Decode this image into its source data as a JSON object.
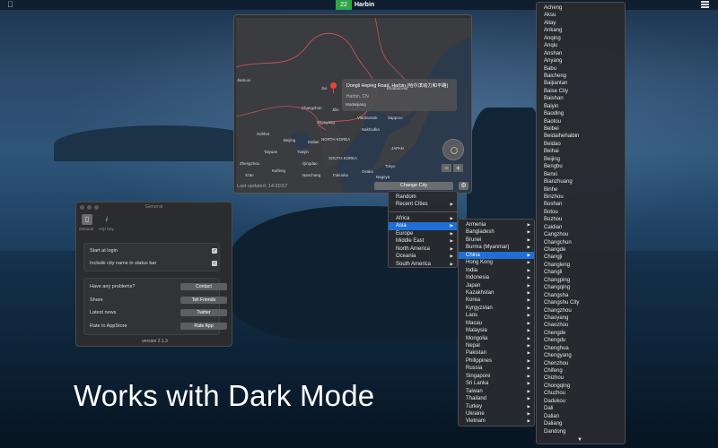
{
  "menubar": {
    "apple_icon": "apple-icon",
    "aqi_value": "22",
    "city": "Harbin",
    "list_icon": "list-icon"
  },
  "map": {
    "place_title": "Dongli Heping Road, Harbin (哈尔滨动力和平路)",
    "place_subtitle": "Harbin, CN",
    "labels": [
      "Jiamusi",
      "Jixi",
      "Khabarovsk",
      "Mudanjiang",
      "Changchun",
      "Jilin",
      "Shenyang",
      "Vladivostok",
      "Nakhodka",
      "Sapporo",
      "Hohhot",
      "Beijing",
      "Dalian",
      "NORTH KOREA",
      "Taiyuan",
      "Tianjin",
      "SOUTH KOREA",
      "JAPAN",
      "Tokyo",
      "Zhengzhou",
      "Qingdao",
      "Xi'an",
      "Kaifeng",
      "Nanchang",
      "Osaka",
      "Fukuoka",
      "Nagoya",
      "Jilin"
    ],
    "last_updated": "Last updated: 14:30:57",
    "change_city": "Change City",
    "zoom_out": "−",
    "zoom_in": "+",
    "gear_icon": "gear-icon"
  },
  "menu_top": {
    "random": "Random",
    "recent": "Recent Cities"
  },
  "regions": [
    "Africa",
    "Asia",
    "Europe",
    "Middle East",
    "North America",
    "Oceania",
    "South America"
  ],
  "countries": [
    "Armenia",
    "Bangladesh",
    "Brunei",
    "Burma (Myanmar)",
    "China",
    "Hong Kong",
    "India",
    "Indonesia",
    "Japan",
    "Kazakhstan",
    "Korea",
    "Kyrgyzstan",
    "Laos",
    "Macau",
    "Malaysia",
    "Mongolia",
    "Nepal",
    "Pakistan",
    "Philippines",
    "Russia",
    "Singapore",
    "Sri Lanka",
    "Taiwan",
    "Thailand",
    "Turkey",
    "Ukraine",
    "Vietnam"
  ],
  "cities": [
    "Acheng",
    "Aksu",
    "Altay",
    "Ankang",
    "Anqing",
    "Anqiu",
    "Anshan",
    "Anyang",
    "Babu",
    "Baicheng",
    "Baijiantan",
    "Baise City",
    "Baishan",
    "Baiyin",
    "Baoding",
    "Baotou",
    "Beibei",
    "Beidaihehaibin",
    "Beidao",
    "Beihai",
    "Beijing",
    "Bengbu",
    "Benxi",
    "Bianzhuang",
    "Binhe",
    "Binzhou",
    "Boshan",
    "Botou",
    "Bozhou",
    "Caidian",
    "Cangzhou",
    "Changchun",
    "Changde",
    "Changji",
    "Changleng",
    "Changli",
    "Changping",
    "Changqing",
    "Changsha",
    "Changshu City",
    "Changzhou",
    "Chaoyang",
    "Chaozhou",
    "Chengde",
    "Chengdu",
    "Chenghua",
    "Chengyang",
    "Chenzhou",
    "Chifeng",
    "Chizhou",
    "Chongqing",
    "Chuzhou",
    "Dadukou",
    "Dali",
    "Dalian",
    "Daliang",
    "Dandong"
  ],
  "prefs": {
    "window_title": "General",
    "tab_general": "General",
    "tab_aqi": "AQI Key",
    "start_at_login": "Start at login",
    "include_city": "Include city name in status bar",
    "problems": "Have any problems?",
    "contact": "Contact",
    "share": "Share",
    "tell_friends": "Tell Friends",
    "latest_news": "Latest news",
    "twitter": "Twitter",
    "rate_label": "Rate in AppStore",
    "rate_app": "Rate App",
    "version": "version 2.1.3",
    "start_checked": true,
    "include_checked": true
  },
  "headline": "Works with Dark Mode",
  "colors": {
    "aqi_green": "#2fa54a",
    "menu_highlight": "#1f6fd6",
    "pin_red": "#e8443a"
  }
}
